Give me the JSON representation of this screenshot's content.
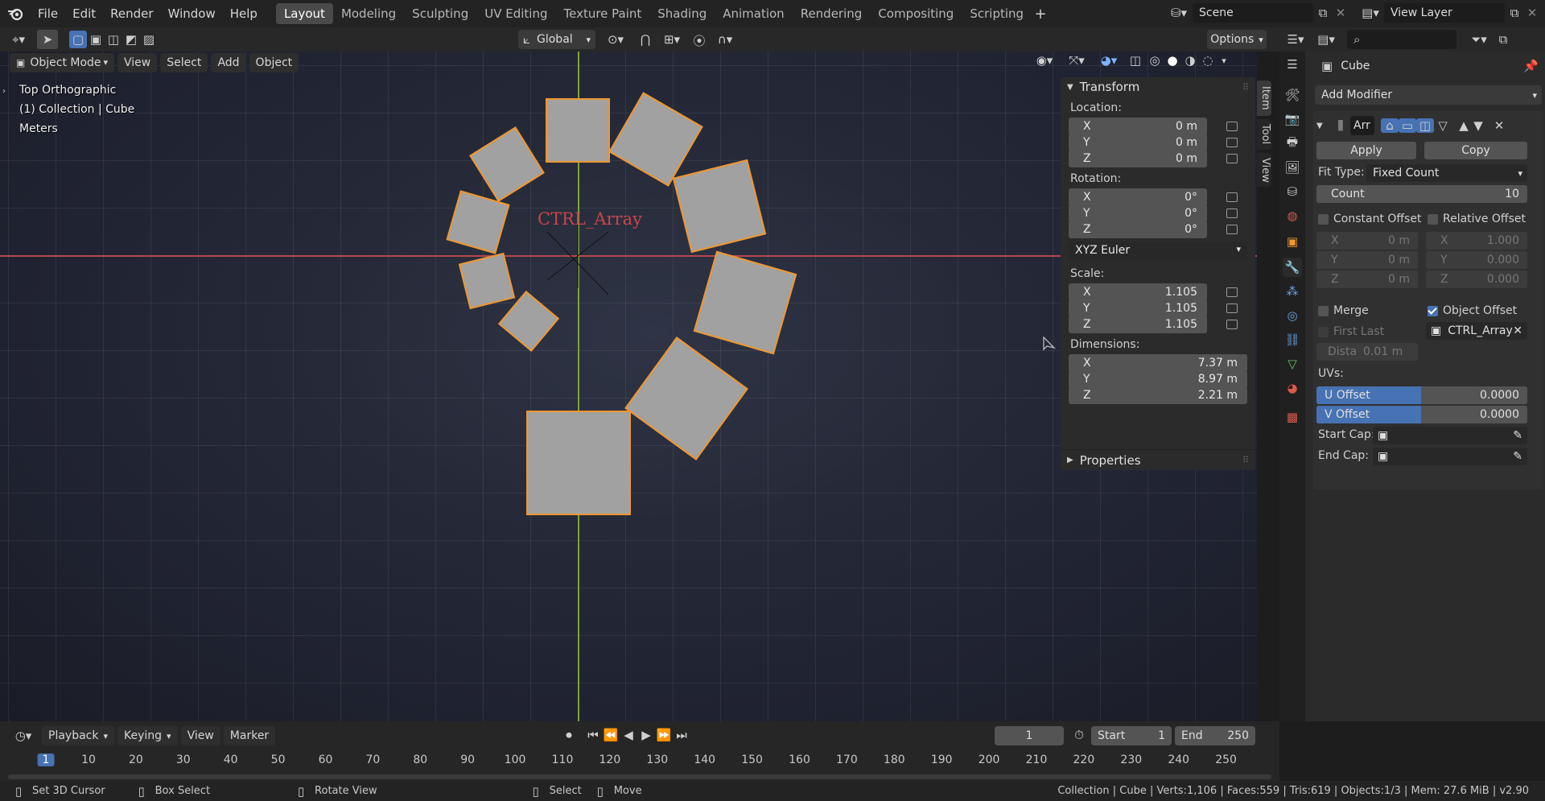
{
  "menus": [
    "File",
    "Edit",
    "Render",
    "Window",
    "Help"
  ],
  "workspaces": [
    "Layout",
    "Modeling",
    "Sculpting",
    "UV Editing",
    "Texture Paint",
    "Shading",
    "Animation",
    "Rendering",
    "Compositing",
    "Scripting"
  ],
  "active_workspace": "Layout",
  "scene": {
    "label": "Scene"
  },
  "view_layer": {
    "label": "View Layer"
  },
  "tool_header": {
    "orientation": "Global",
    "options_label": "Options"
  },
  "viewport_header": {
    "mode": "Object Mode",
    "menus": [
      "View",
      "Select",
      "Add",
      "Object"
    ]
  },
  "viewport_info": {
    "view_name": "Top Orthographic",
    "collection": "(1) Collection | Cube",
    "units": "Meters"
  },
  "viewport_object_label": "CTRL_Array",
  "npanel": {
    "tabs": [
      "Item",
      "Tool",
      "View"
    ],
    "transform_title": "Transform",
    "location_label": "Location:",
    "location": [
      {
        "axis": "X",
        "value": "0 m"
      },
      {
        "axis": "Y",
        "value": "0 m"
      },
      {
        "axis": "Z",
        "value": "0 m"
      }
    ],
    "rotation_label": "Rotation:",
    "rotation": [
      {
        "axis": "X",
        "value": "0°"
      },
      {
        "axis": "Y",
        "value": "0°"
      },
      {
        "axis": "Z",
        "value": "0°"
      }
    ],
    "rotation_mode": "XYZ Euler",
    "scale_label": "Scale:",
    "scale": [
      {
        "axis": "X",
        "value": "1.105"
      },
      {
        "axis": "Y",
        "value": "1.105"
      },
      {
        "axis": "Z",
        "value": "1.105"
      }
    ],
    "dimensions_label": "Dimensions:",
    "dimensions": [
      {
        "axis": "X",
        "value": "7.37 m"
      },
      {
        "axis": "Y",
        "value": "8.97 m"
      },
      {
        "axis": "Z",
        "value": "2.21 m"
      }
    ],
    "properties_title": "Properties"
  },
  "properties": {
    "object_name": "Cube",
    "add_modifier": "Add Modifier",
    "modifier_name": "Arr",
    "apply_label": "Apply",
    "copy_label": "Copy",
    "fit_type_label": "Fit Type:",
    "fit_type": "Fixed Count",
    "count_label": "Count",
    "count_value": "10",
    "constant_offset": "Constant Offset",
    "relative_offset": "Relative Offset",
    "const_vals": [
      {
        "axis": "X",
        "value": "0 m"
      },
      {
        "axis": "Y",
        "value": "0 m"
      },
      {
        "axis": "Z",
        "value": "0 m"
      }
    ],
    "rel_vals": [
      {
        "axis": "X",
        "value": "1.000"
      },
      {
        "axis": "Y",
        "value": "0.000"
      },
      {
        "axis": "Z",
        "value": "0.000"
      }
    ],
    "merge": "Merge",
    "object_offset": "Object Offset",
    "first_last": "First Last",
    "offset_object": "CTRL_Array",
    "distance_label": "Dista",
    "distance_value": "0.01 m",
    "uvs_label": "UVs:",
    "u_offset_label": "U Offset",
    "u_offset_value": "0.0000",
    "v_offset_label": "V Offset",
    "v_offset_value": "0.0000",
    "start_cap": "Start Cap:",
    "end_cap": "End Cap:"
  },
  "timeline": {
    "menus": [
      "Playback",
      "Keying",
      "View",
      "Marker"
    ],
    "current_frame": "1",
    "start_label": "Start",
    "start_value": "1",
    "end_label": "End",
    "end_value": "250",
    "ticks": [
      "1",
      "10",
      "20",
      "30",
      "40",
      "50",
      "60",
      "70",
      "80",
      "90",
      "100",
      "110",
      "120",
      "130",
      "140",
      "150",
      "160",
      "170",
      "180",
      "190",
      "200",
      "210",
      "220",
      "230",
      "240",
      "250"
    ]
  },
  "statusbar": {
    "set_cursor": "Set 3D Cursor",
    "box_select": "Box Select",
    "rotate_view": "Rotate View",
    "select": "Select",
    "move": "Move",
    "stats": "Collection | Cube | Verts:1,106 | Faces:559 | Tris:619 | Objects:1/3 | Mem: 27.6 MiB | v2.90"
  },
  "colors": {
    "accent": "#4772b3",
    "selection_outline": "#f0962f",
    "x_axis": "#b8474c",
    "y_axis": "#7ea33a"
  }
}
